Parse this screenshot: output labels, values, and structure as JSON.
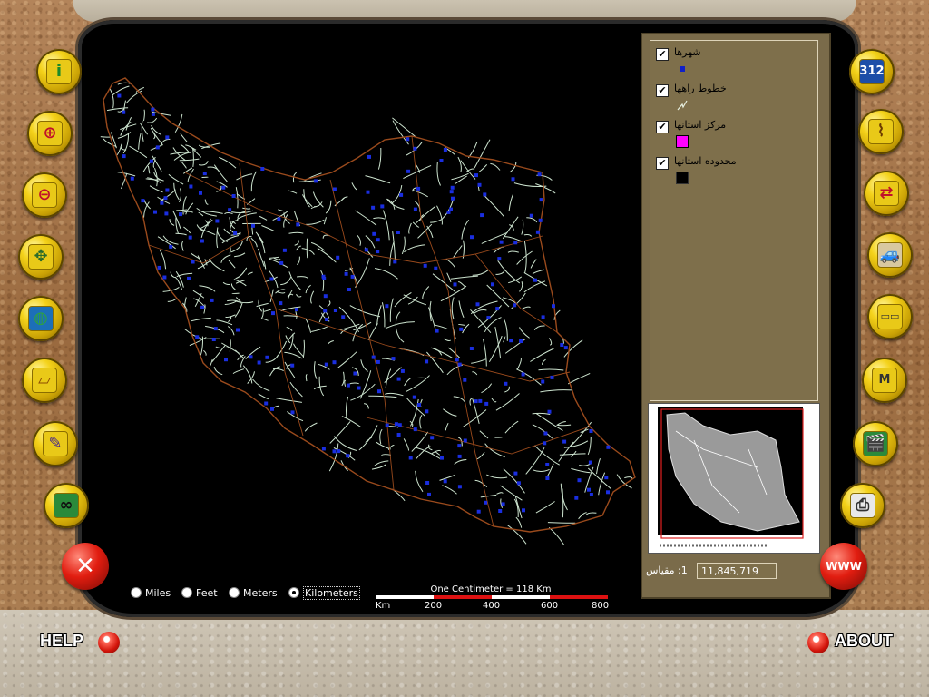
{
  "legend": {
    "items": [
      {
        "label": "شهرها",
        "checked": true,
        "swatch": "square-blue",
        "color": "#1020c8"
      },
      {
        "label": "خطوط راهها",
        "checked": true,
        "swatch": "line",
        "color": "#ffffff"
      },
      {
        "label": "مرکز استانها",
        "checked": true,
        "swatch": "square-magenta",
        "color": "#ff00ff"
      },
      {
        "label": "محدوده استانها",
        "checked": true,
        "swatch": "square-black",
        "color": "#000000"
      }
    ]
  },
  "scale": {
    "label": "1: مقیاس",
    "value": "11,845,719"
  },
  "units": {
    "options": [
      "Miles",
      "Feet",
      "Meters",
      "Kilometers"
    ],
    "selected": "Kilometers"
  },
  "scalebar": {
    "title": "One Centimeter = 118 Km",
    "unit": "Km",
    "ticks": [
      "200",
      "400",
      "600",
      "800"
    ]
  },
  "toolbar_left": [
    {
      "icon": "info-icon"
    },
    {
      "icon": "zoom-in-icon"
    },
    {
      "icon": "zoom-out-icon"
    },
    {
      "icon": "pan-map-icon"
    },
    {
      "icon": "globe-icon"
    },
    {
      "icon": "full-extent-icon"
    },
    {
      "icon": "measure-icon"
    },
    {
      "icon": "binoculars-icon"
    }
  ],
  "toolbar_right": [
    {
      "icon": "numbers-icon"
    },
    {
      "icon": "route-icon"
    },
    {
      "icon": "start-end-icon"
    },
    {
      "icon": "car-icon"
    },
    {
      "icon": "ruler-icon"
    },
    {
      "icon": "ruler-m-icon"
    },
    {
      "icon": "film-clapper-icon"
    },
    {
      "icon": "print-icon"
    }
  ],
  "exit_label": "✕",
  "www_label": "WWW",
  "help_label": "HELP",
  "about_label": "ABOUT",
  "colors": {
    "city": "#1020c8",
    "road": "#cde4cf",
    "border": "#9a4a1c"
  }
}
